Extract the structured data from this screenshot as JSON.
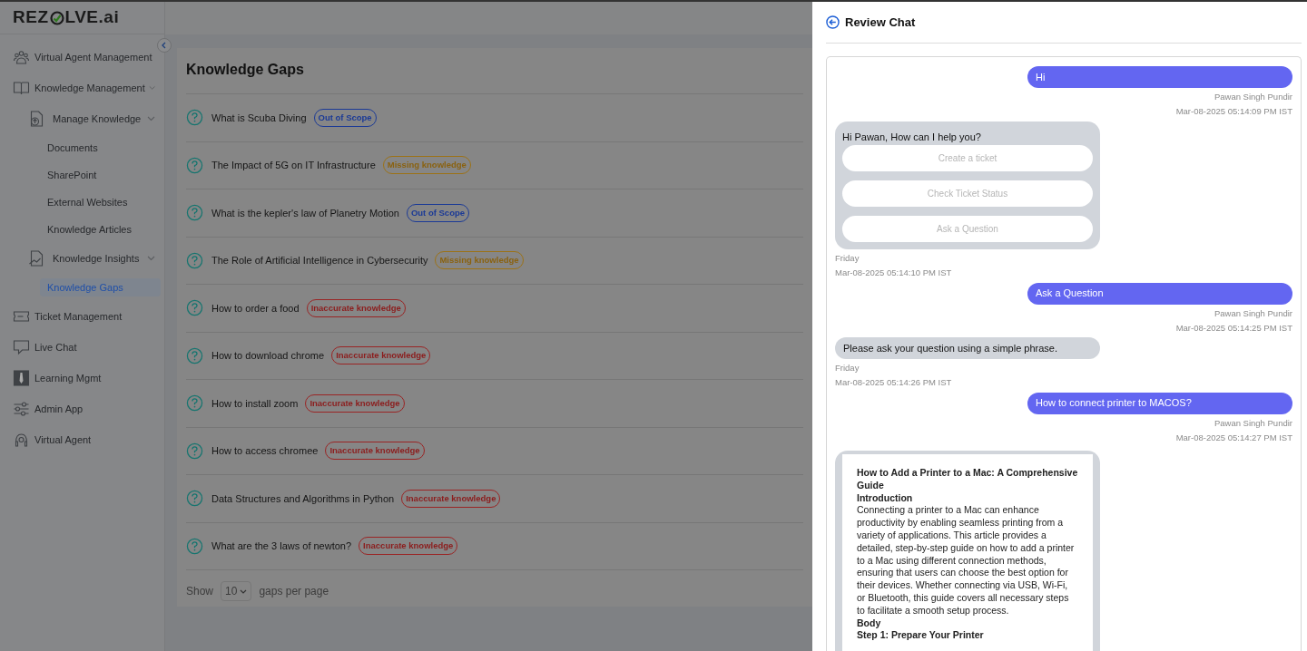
{
  "sidebar": {
    "logo": {
      "before": "REZ",
      "after": "LVE.ai"
    },
    "items": [
      {
        "label": "Virtual Agent Management",
        "selected": false
      },
      {
        "label": "Knowledge Management",
        "selected": false,
        "expanded": true,
        "children": [
          {
            "label": "Manage Knowledge",
            "selected": false,
            "expanded": true,
            "children": [
              {
                "label": "Documents",
                "selected": false
              },
              {
                "label": "SharePoint",
                "selected": false
              },
              {
                "label": "External Websites",
                "selected": false
              },
              {
                "label": "Knowledge Articles",
                "selected": false
              }
            ]
          },
          {
            "label": "Knowledge Insights",
            "selected": false,
            "expanded": true,
            "children": [
              {
                "label": "Knowledge Gaps",
                "selected": true
              }
            ]
          }
        ]
      },
      {
        "label": "Ticket Management",
        "selected": false
      },
      {
        "label": "Live Chat",
        "selected": false
      },
      {
        "label": "Learning Mgmt",
        "selected": false
      },
      {
        "label": "Admin App",
        "selected": false
      },
      {
        "label": "Virtual Agent",
        "selected": false
      }
    ]
  },
  "knowledge_gaps": {
    "title": "Knowledge Gaps",
    "rows": [
      {
        "question": "What is Scuba Diving",
        "tag": {
          "label": "Out of Scope",
          "kind": "scope"
        }
      },
      {
        "question": "The Impact of 5G on IT Infrastructure",
        "tag": {
          "label": "Missing knowledge",
          "kind": "missing"
        }
      },
      {
        "question": "What is the kepler's law of Planetry Motion",
        "tag": {
          "label": "Out of Scope",
          "kind": "scope"
        }
      },
      {
        "question": "The Role of Artificial Intelligence in Cybersecurity",
        "tag": {
          "label": "Missing knowledge",
          "kind": "missing"
        }
      },
      {
        "question": "How to order a food",
        "tag": {
          "label": "Inaccurate knowledge",
          "kind": "inaccurate"
        }
      },
      {
        "question": "How to download chrome",
        "tag": {
          "label": "Inaccurate knowledge",
          "kind": "inaccurate"
        }
      },
      {
        "question": "How to install zoom",
        "tag": {
          "label": "Inaccurate knowledge",
          "kind": "inaccurate"
        }
      },
      {
        "question": "How to access chromee",
        "tag": {
          "label": "Inaccurate knowledge",
          "kind": "inaccurate"
        }
      },
      {
        "question": "Data Structures and Algorithms in Python",
        "tag": {
          "label": "Inaccurate knowledge",
          "kind": "inaccurate"
        }
      },
      {
        "question": "What are the 3 laws of newton?",
        "tag": {
          "label": "Inaccurate knowledge",
          "kind": "inaccurate"
        }
      }
    ],
    "footer": {
      "show": "Show",
      "page_size": "10",
      "suffix": "gaps per page"
    }
  },
  "review_chat": {
    "title": "Review Chat",
    "messages": [
      {
        "kind": "user",
        "text": "Hi",
        "author": "Pawan Singh Pundir",
        "time": "Mar-08-2025 05:14:09 PM IST"
      },
      {
        "kind": "bot",
        "text": "Hi Pawan, How can I help you?",
        "options": [
          "Create a ticket",
          "Check Ticket Status",
          "Ask a Question"
        ],
        "day": "Friday",
        "time": "Mar-08-2025 05:14:10 PM IST"
      },
      {
        "kind": "user",
        "text": "Ask a Question",
        "author": "Pawan Singh Pundir",
        "time": "Mar-08-2025 05:14:25 PM IST"
      },
      {
        "kind": "bot",
        "text": "Please ask your question using a simple phrase.",
        "day": "Friday",
        "time": "Mar-08-2025 05:14:26 PM IST"
      },
      {
        "kind": "user",
        "text": "How to connect printer to MACOS?",
        "author": "Pawan Singh Pundir",
        "time": "Mar-08-2025 05:14:27 PM IST"
      },
      {
        "kind": "article",
        "blocks": [
          {
            "kind": "heading",
            "text": "How to Add a Printer to a Mac: A Comprehensive Guide"
          },
          {
            "kind": "heading",
            "text": "Introduction"
          },
          {
            "kind": "paragraph",
            "text": "Connecting a printer to a Mac can enhance productivity by enabling seamless printing from a variety of applications. This article provides a detailed, step-by-step guide on how to add a printer to a Mac using different connection methods, ensuring that users can choose the best option for their devices. Whether connecting via USB, Wi-Fi, or Bluetooth, this guide covers all necessary steps to facilitate a smooth setup process."
          },
          {
            "kind": "heading",
            "text": "Body"
          },
          {
            "kind": "heading",
            "text": "Step 1: Prepare Your Printer"
          }
        ]
      }
    ]
  }
}
